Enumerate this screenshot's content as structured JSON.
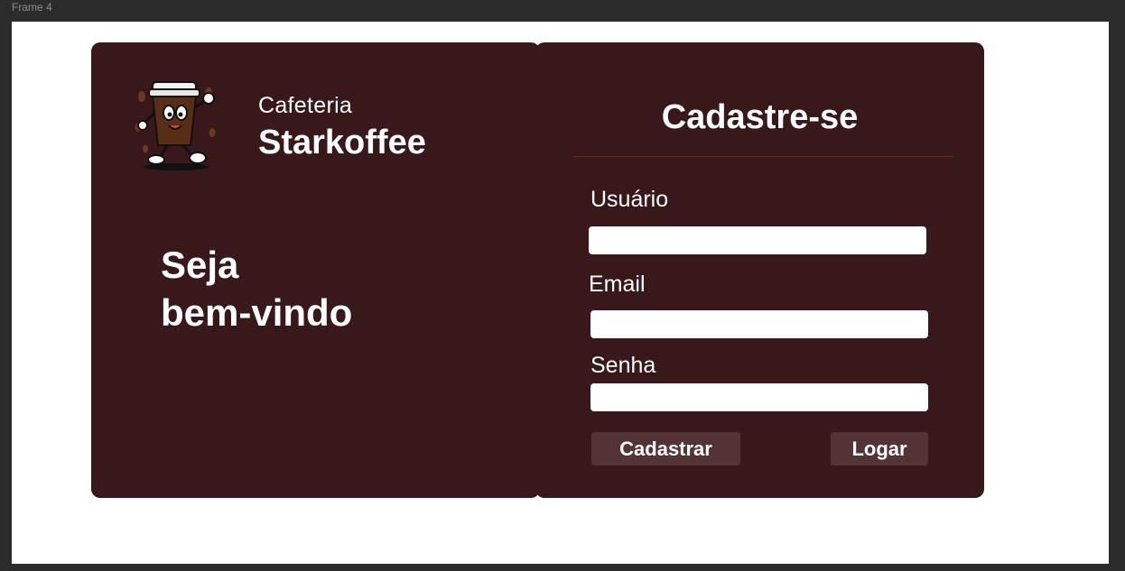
{
  "frame": {
    "label": "Frame 4"
  },
  "brand": {
    "subtitle": "Cafeteria",
    "name": "Starkoffee",
    "logo_icon": "coffee-cup-mascot-icon"
  },
  "welcome": {
    "line1": "Seja",
    "line2": "bem-vindo"
  },
  "form": {
    "title": "Cadastre-se",
    "fields": [
      {
        "label": "Usuário",
        "value": "",
        "placeholder": ""
      },
      {
        "label": "Email",
        "value": "",
        "placeholder": ""
      },
      {
        "label": "Senha",
        "value": "",
        "placeholder": ""
      }
    ],
    "register_label": "Cadastrar",
    "login_label": "Logar"
  },
  "colors": {
    "panel": "#38181a",
    "button": "#533336",
    "canvas": "#ffffff",
    "background": "#2c2c2c"
  }
}
